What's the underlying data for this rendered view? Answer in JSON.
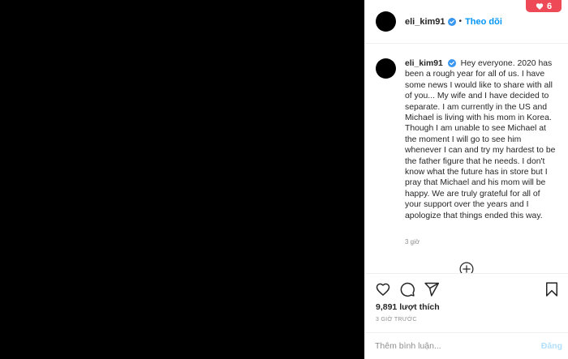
{
  "post": {
    "username": "eli_kim91",
    "separator": "•",
    "follow_label": "Theo dõi",
    "caption": "Hey everyone. 2020 has been a rough year for all of us. I have some news I would like to share with all of you... My wife and I have decided to separate. I am currently in the US and Michael is living with his mom in Korea. Though I am unable to see Michael at the moment I will go to see him whenever I can and try my hardest to be the father figure that he needs. I don't know what the future has in store but I pray that Michael and his mom will be happy. We are truly grateful for all of your support over the years and I apologize that things ended this way.",
    "caption_time": "3 giờ",
    "likes": "9,891 lượt thích",
    "post_time": "3 GIỜ TRƯỚC"
  },
  "notification": {
    "count": "6",
    "icon": "heart-icon",
    "color": "#ed4956"
  },
  "comment_box": {
    "placeholder": "Thêm bình luận...",
    "post_label": "Đăng"
  },
  "icons": {
    "like": "heart-outline-icon",
    "comment": "comment-bubble-icon",
    "share": "paper-plane-icon",
    "save": "bookmark-icon",
    "load_more": "plus-circle-icon",
    "verified": "verified-badge-icon"
  },
  "colors": {
    "accent": "#0095f6",
    "verified": "#3897f0",
    "muted": "#8e8e8e",
    "post_disabled": "#b2dffc"
  }
}
